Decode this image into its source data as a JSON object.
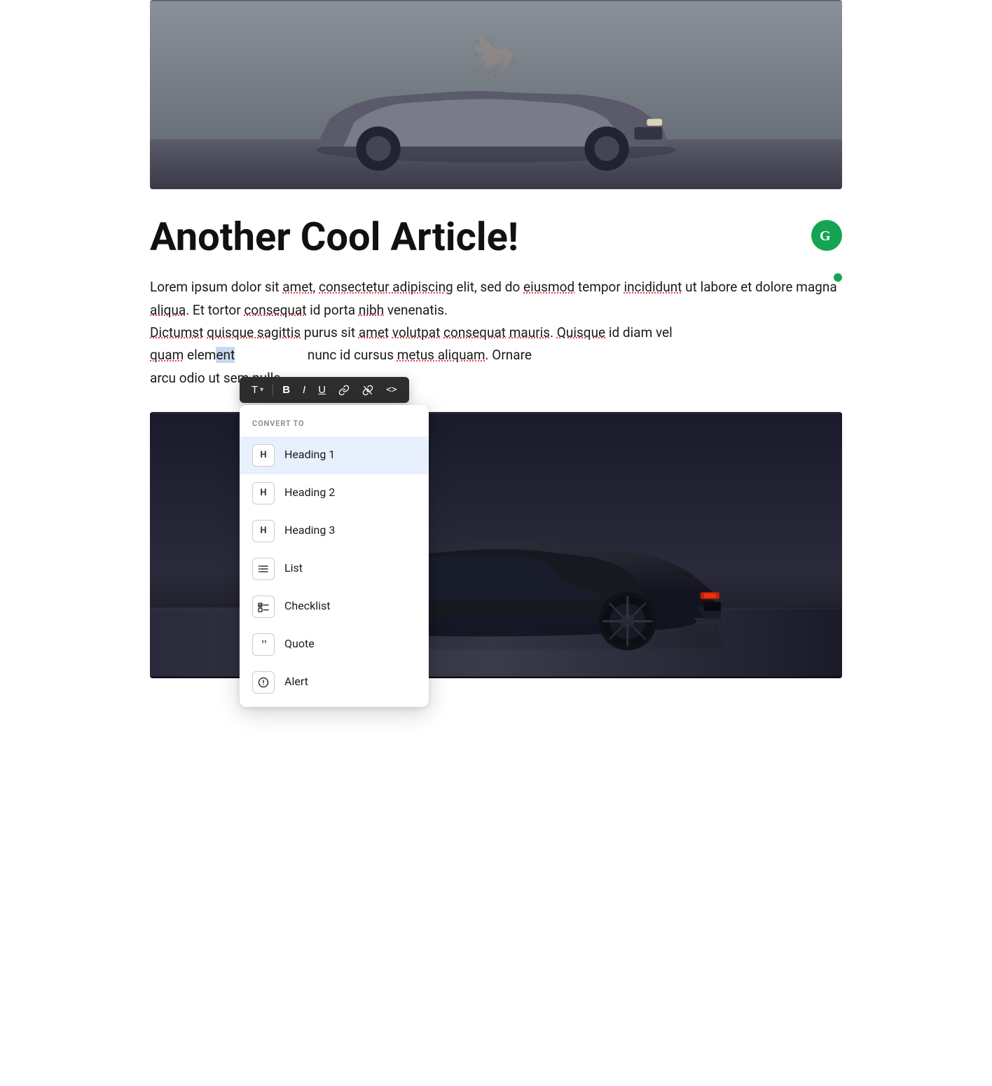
{
  "article": {
    "title": "Another Cool Article!",
    "hero_image_alt": "Gray Ford Mustang car photo",
    "body_text_line1": "Lorem ipsum dolor sit amet, consectetur adipiscing elit, sed do eiusmod tempor",
    "body_text_line2": "incididunt ut labore et dolore magna aliqua. Et tortor consequat id porta nibh venenatis.",
    "body_text_line3": "Dictumst quisque sagittis purus sit amet volutpat consequat mauris. Quisque id diam vel",
    "body_text_line4": "quam elem",
    "body_text_line4b": "nunc id cursus metus aliquam. Ornare",
    "body_text_line5": "arcu odio ut sem nulla.",
    "selected_text": "ent",
    "second_image_alt": "Black Chevrolet Camaro car photo"
  },
  "inline_toolbar": {
    "text_button_label": "T",
    "chevron_label": "▾",
    "bold_label": "B",
    "italic_label": "I",
    "underline_label": "U",
    "link_label": "🔗",
    "unlink_label": "⛓",
    "code_label": "<>"
  },
  "convert_to_menu": {
    "section_label": "CONVERT TO",
    "items": [
      {
        "id": "heading1",
        "icon_type": "H",
        "label": "Heading 1",
        "active": true
      },
      {
        "id": "heading2",
        "icon_type": "H",
        "label": "Heading 2",
        "active": false
      },
      {
        "id": "heading3",
        "icon_type": "H",
        "label": "Heading 3",
        "active": false
      },
      {
        "id": "list",
        "icon_type": "list",
        "label": "List",
        "active": false
      },
      {
        "id": "checklist",
        "icon_type": "check",
        "label": "Checklist",
        "active": false
      },
      {
        "id": "quote",
        "icon_type": "quote",
        "label": "Quote",
        "active": false
      },
      {
        "id": "alert",
        "icon_type": "alert",
        "label": "Alert",
        "active": false
      }
    ]
  },
  "grammarly": {
    "icon_letter": "G",
    "color": "#15a552"
  }
}
